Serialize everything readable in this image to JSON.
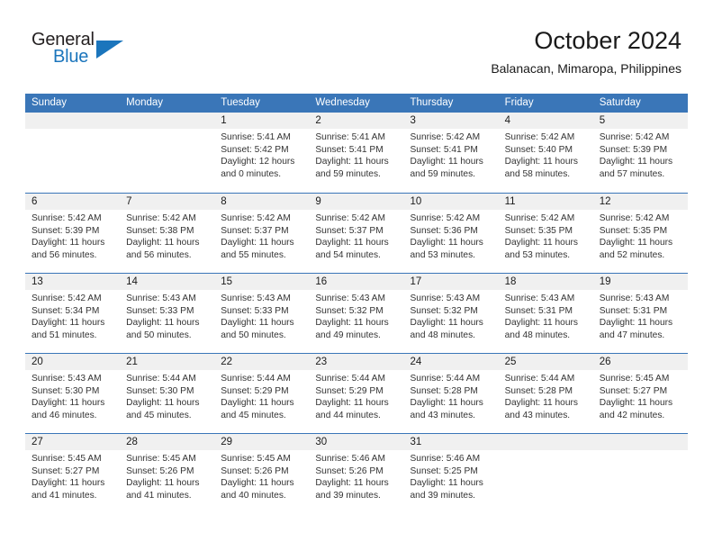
{
  "brand": {
    "name_part1": "General",
    "name_part2": "Blue",
    "triangle_icon": "triangle-icon",
    "accent_color": "#1b75bc"
  },
  "header": {
    "title": "October 2024",
    "subtitle": "Balanacan, Mimaropa, Philippines"
  },
  "calendar": {
    "header_color": "#3a76b8",
    "daynum_background": "#f0f0f0",
    "weekdays": [
      "Sunday",
      "Monday",
      "Tuesday",
      "Wednesday",
      "Thursday",
      "Friday",
      "Saturday"
    ],
    "weeks": [
      [
        {
          "day": "",
          "empty": true
        },
        {
          "day": "",
          "empty": true
        },
        {
          "day": "1",
          "sunrise": "Sunrise: 5:41 AM",
          "sunset": "Sunset: 5:42 PM",
          "daylight": "Daylight: 12 hours and 0 minutes."
        },
        {
          "day": "2",
          "sunrise": "Sunrise: 5:41 AM",
          "sunset": "Sunset: 5:41 PM",
          "daylight": "Daylight: 11 hours and 59 minutes."
        },
        {
          "day": "3",
          "sunrise": "Sunrise: 5:42 AM",
          "sunset": "Sunset: 5:41 PM",
          "daylight": "Daylight: 11 hours and 59 minutes."
        },
        {
          "day": "4",
          "sunrise": "Sunrise: 5:42 AM",
          "sunset": "Sunset: 5:40 PM",
          "daylight": "Daylight: 11 hours and 58 minutes."
        },
        {
          "day": "5",
          "sunrise": "Sunrise: 5:42 AM",
          "sunset": "Sunset: 5:39 PM",
          "daylight": "Daylight: 11 hours and 57 minutes."
        }
      ],
      [
        {
          "day": "6",
          "sunrise": "Sunrise: 5:42 AM",
          "sunset": "Sunset: 5:39 PM",
          "daylight": "Daylight: 11 hours and 56 minutes."
        },
        {
          "day": "7",
          "sunrise": "Sunrise: 5:42 AM",
          "sunset": "Sunset: 5:38 PM",
          "daylight": "Daylight: 11 hours and 56 minutes."
        },
        {
          "day": "8",
          "sunrise": "Sunrise: 5:42 AM",
          "sunset": "Sunset: 5:37 PM",
          "daylight": "Daylight: 11 hours and 55 minutes."
        },
        {
          "day": "9",
          "sunrise": "Sunrise: 5:42 AM",
          "sunset": "Sunset: 5:37 PM",
          "daylight": "Daylight: 11 hours and 54 minutes."
        },
        {
          "day": "10",
          "sunrise": "Sunrise: 5:42 AM",
          "sunset": "Sunset: 5:36 PM",
          "daylight": "Daylight: 11 hours and 53 minutes."
        },
        {
          "day": "11",
          "sunrise": "Sunrise: 5:42 AM",
          "sunset": "Sunset: 5:35 PM",
          "daylight": "Daylight: 11 hours and 53 minutes."
        },
        {
          "day": "12",
          "sunrise": "Sunrise: 5:42 AM",
          "sunset": "Sunset: 5:35 PM",
          "daylight": "Daylight: 11 hours and 52 minutes."
        }
      ],
      [
        {
          "day": "13",
          "sunrise": "Sunrise: 5:42 AM",
          "sunset": "Sunset: 5:34 PM",
          "daylight": "Daylight: 11 hours and 51 minutes."
        },
        {
          "day": "14",
          "sunrise": "Sunrise: 5:43 AM",
          "sunset": "Sunset: 5:33 PM",
          "daylight": "Daylight: 11 hours and 50 minutes."
        },
        {
          "day": "15",
          "sunrise": "Sunrise: 5:43 AM",
          "sunset": "Sunset: 5:33 PM",
          "daylight": "Daylight: 11 hours and 50 minutes."
        },
        {
          "day": "16",
          "sunrise": "Sunrise: 5:43 AM",
          "sunset": "Sunset: 5:32 PM",
          "daylight": "Daylight: 11 hours and 49 minutes."
        },
        {
          "day": "17",
          "sunrise": "Sunrise: 5:43 AM",
          "sunset": "Sunset: 5:32 PM",
          "daylight": "Daylight: 11 hours and 48 minutes."
        },
        {
          "day": "18",
          "sunrise": "Sunrise: 5:43 AM",
          "sunset": "Sunset: 5:31 PM",
          "daylight": "Daylight: 11 hours and 48 minutes."
        },
        {
          "day": "19",
          "sunrise": "Sunrise: 5:43 AM",
          "sunset": "Sunset: 5:31 PM",
          "daylight": "Daylight: 11 hours and 47 minutes."
        }
      ],
      [
        {
          "day": "20",
          "sunrise": "Sunrise: 5:43 AM",
          "sunset": "Sunset: 5:30 PM",
          "daylight": "Daylight: 11 hours and 46 minutes."
        },
        {
          "day": "21",
          "sunrise": "Sunrise: 5:44 AM",
          "sunset": "Sunset: 5:30 PM",
          "daylight": "Daylight: 11 hours and 45 minutes."
        },
        {
          "day": "22",
          "sunrise": "Sunrise: 5:44 AM",
          "sunset": "Sunset: 5:29 PM",
          "daylight": "Daylight: 11 hours and 45 minutes."
        },
        {
          "day": "23",
          "sunrise": "Sunrise: 5:44 AM",
          "sunset": "Sunset: 5:29 PM",
          "daylight": "Daylight: 11 hours and 44 minutes."
        },
        {
          "day": "24",
          "sunrise": "Sunrise: 5:44 AM",
          "sunset": "Sunset: 5:28 PM",
          "daylight": "Daylight: 11 hours and 43 minutes."
        },
        {
          "day": "25",
          "sunrise": "Sunrise: 5:44 AM",
          "sunset": "Sunset: 5:28 PM",
          "daylight": "Daylight: 11 hours and 43 minutes."
        },
        {
          "day": "26",
          "sunrise": "Sunrise: 5:45 AM",
          "sunset": "Sunset: 5:27 PM",
          "daylight": "Daylight: 11 hours and 42 minutes."
        }
      ],
      [
        {
          "day": "27",
          "sunrise": "Sunrise: 5:45 AM",
          "sunset": "Sunset: 5:27 PM",
          "daylight": "Daylight: 11 hours and 41 minutes."
        },
        {
          "day": "28",
          "sunrise": "Sunrise: 5:45 AM",
          "sunset": "Sunset: 5:26 PM",
          "daylight": "Daylight: 11 hours and 41 minutes."
        },
        {
          "day": "29",
          "sunrise": "Sunrise: 5:45 AM",
          "sunset": "Sunset: 5:26 PM",
          "daylight": "Daylight: 11 hours and 40 minutes."
        },
        {
          "day": "30",
          "sunrise": "Sunrise: 5:46 AM",
          "sunset": "Sunset: 5:26 PM",
          "daylight": "Daylight: 11 hours and 39 minutes."
        },
        {
          "day": "31",
          "sunrise": "Sunrise: 5:46 AM",
          "sunset": "Sunset: 5:25 PM",
          "daylight": "Daylight: 11 hours and 39 minutes."
        },
        {
          "day": "",
          "empty": true
        },
        {
          "day": "",
          "empty": true
        }
      ]
    ]
  }
}
